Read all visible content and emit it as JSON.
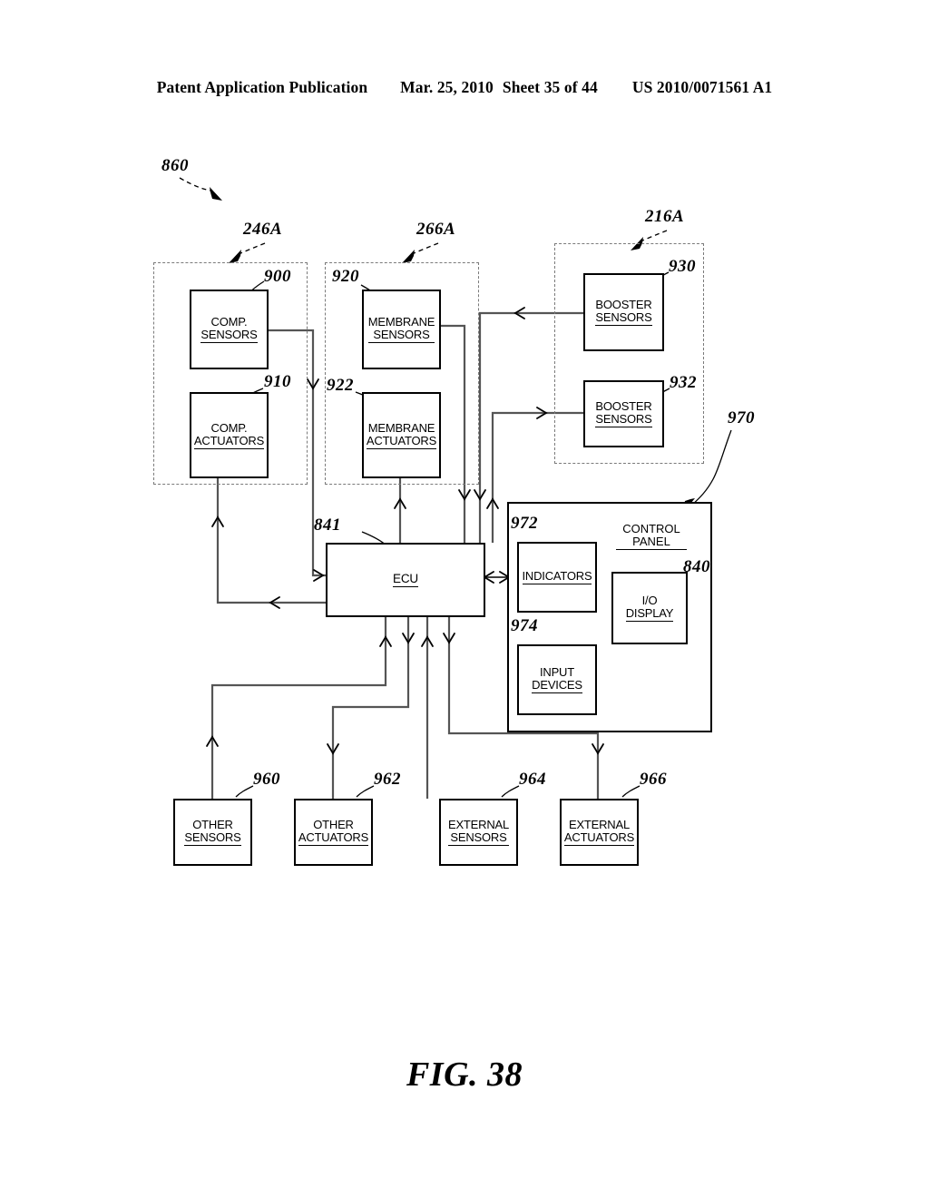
{
  "header": {
    "publication": "Patent Application Publication",
    "date": "Mar. 25, 2010",
    "sheet": "Sheet 35 of 44",
    "docnum": "US 2010/0071561 A1"
  },
  "figure": {
    "caption": "FIG. 38",
    "system_ref": "860"
  },
  "groups": [
    {
      "id": "comp-group",
      "ref": "246A"
    },
    {
      "id": "membrane-group",
      "ref": "266A"
    },
    {
      "id": "booster-group",
      "ref": "216A"
    }
  ],
  "blocks": [
    {
      "id": "comp-sensors",
      "label": "COMP.\nSENSORS",
      "ref": "900"
    },
    {
      "id": "comp-actuators",
      "label": "COMP.\nACTUATORS",
      "ref": "910"
    },
    {
      "id": "membrane-sensors",
      "label": "MEMBRANE\nSENSORS",
      "ref": "920"
    },
    {
      "id": "membrane-actuators",
      "label": "MEMBRANE\nACTUATORS",
      "ref": "922"
    },
    {
      "id": "booster-sensors-1",
      "label": "BOOSTER\nSENSORS",
      "ref": "930"
    },
    {
      "id": "booster-sensors-2",
      "label": "BOOSTER\nSENSORS",
      "ref": "932"
    },
    {
      "id": "ecu",
      "label": "ECU",
      "ref": "841"
    },
    {
      "id": "indicators",
      "label": "INDICATORS",
      "ref": "972"
    },
    {
      "id": "input-devices",
      "label": "INPUT\nDEVICES",
      "ref": "974"
    },
    {
      "id": "io-display",
      "label": "I/O\nDISPLAY",
      "ref": "840"
    },
    {
      "id": "other-sensors",
      "label": "OTHER\nSENSORS",
      "ref": "960"
    },
    {
      "id": "other-actuators",
      "label": "OTHER\nACTUATORS",
      "ref": "962"
    },
    {
      "id": "external-sensors",
      "label": "EXTERNAL\nSENSORS",
      "ref": "964"
    },
    {
      "id": "external-actuators",
      "label": "EXTERNAL\nACTUATORS",
      "ref": "966"
    }
  ],
  "control_panel": {
    "title": "CONTROL\nPANEL",
    "ref": "970"
  },
  "colors": {
    "ink": "#000000",
    "dashed_group": "#7a7a7a",
    "wire": "#555555"
  }
}
